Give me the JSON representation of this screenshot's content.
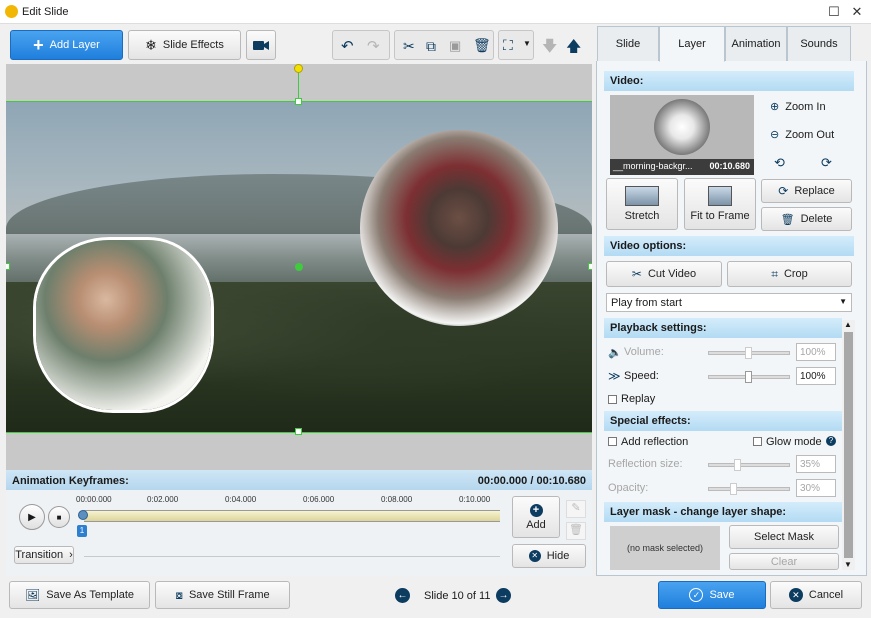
{
  "window": {
    "title": "Edit Slide"
  },
  "toolbar": {
    "add_layer": "Add Layer",
    "slide_effects": "Slide Effects"
  },
  "tabs": [
    "Slide",
    "Layer",
    "Animation",
    "Sounds"
  ],
  "active_tab": "Layer",
  "video": {
    "header": "Video:",
    "filename": "__morning-backgr...",
    "duration": "00:10.680",
    "zoom_in": "Zoom In",
    "zoom_out": "Zoom Out",
    "stretch": "Stretch",
    "fit_to_frame": "Fit to Frame",
    "replace": "Replace",
    "delete": "Delete"
  },
  "video_options": {
    "header": "Video options:",
    "cut_video": "Cut Video",
    "crop": "Crop",
    "playback_mode": "Play from start"
  },
  "playback": {
    "header": "Playback settings:",
    "volume_label": "Volume:",
    "volume_value": "100%",
    "speed_label": "Speed:",
    "speed_value": "100%",
    "replay": "Replay"
  },
  "special": {
    "header": "Special effects:",
    "add_reflection": "Add reflection",
    "glow_mode": "Glow mode",
    "reflection_size_label": "Reflection size:",
    "reflection_size_value": "35%",
    "opacity_label": "Opacity:",
    "opacity_value": "30%"
  },
  "mask": {
    "header": "Layer mask - change layer shape:",
    "none": "(no mask selected)",
    "select": "Select Mask",
    "clear": "Clear"
  },
  "keyframes": {
    "header": "Animation Keyframes:",
    "time": "00:00.000 / 00:10.680",
    "ticks": [
      "00:00.000",
      "0:02.000",
      "0:04.000",
      "0:06.000",
      "0:08.000",
      "0:10.000"
    ],
    "marker": "1",
    "add": "Add",
    "transition": "Transition",
    "hide": "Hide"
  },
  "footer": {
    "save_template": "Save As Template",
    "save_frame": "Save Still Frame",
    "slide_counter": "Slide 10 of 11",
    "save": "Save",
    "cancel": "Cancel"
  },
  "colors": {
    "accent": "#1f7fdc",
    "selection": "#3ecb3e",
    "section_header": "#b3dbf3"
  }
}
